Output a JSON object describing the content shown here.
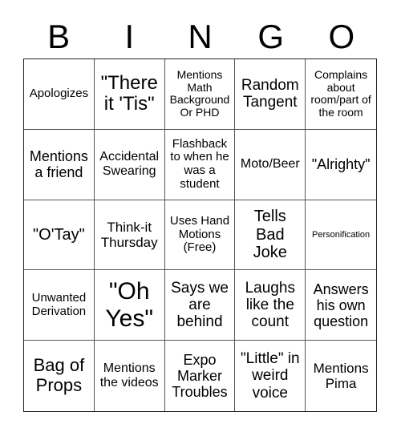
{
  "header": {
    "letters": [
      "B",
      "I",
      "N",
      "G",
      "O"
    ]
  },
  "board": {
    "rows": [
      [
        "Apologizes",
        "\"There it 'Tis\"",
        "Mentions Math Background Or PHD",
        "Random Tangent",
        "Complains about room/part of the room"
      ],
      [
        "Mentions a friend",
        "Accidental Swearing",
        "Flashback to when he was a student",
        "Moto/Beer",
        "\"Alrighty\""
      ],
      [
        "\"O'Tay\"",
        "Think-it Thursday",
        "Uses Hand Motions (Free)",
        "Tells Bad Joke",
        "Personification"
      ],
      [
        "Unwanted Derivation",
        "\"Oh Yes\"",
        "Says we are behind",
        "Laughs like the count",
        "Answers his own question"
      ],
      [
        "Bag of Props",
        "Mentions the videos",
        "Expo Marker Troubles",
        "\"Little\" in weird voice",
        "Mentions Pima"
      ]
    ]
  }
}
